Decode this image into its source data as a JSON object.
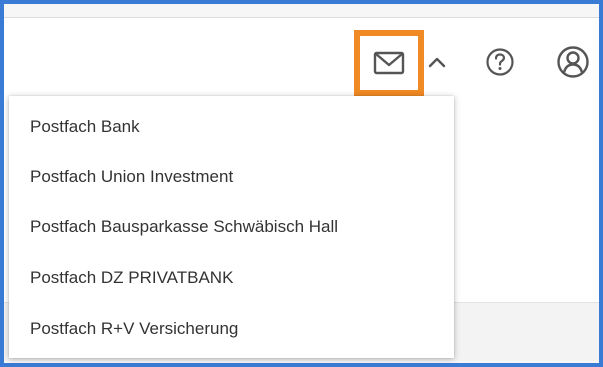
{
  "toolbar": {
    "mail_icon": "mail-envelope-icon",
    "chevron_icon": "chevron-up-icon",
    "help_icon": "help-question-icon",
    "user_icon": "user-account-icon",
    "highlight_color": "#f08a24",
    "icon_color": "#555555"
  },
  "mailbox_menu": {
    "items": [
      {
        "label": "Postfach Bank"
      },
      {
        "label": "Postfach Union Investment"
      },
      {
        "label": "Postfach Bausparkasse Schwäbisch Hall"
      },
      {
        "label": "Postfach DZ PRIVATBANK"
      },
      {
        "label": "Postfach R+V Versicherung"
      }
    ]
  },
  "frame": {
    "border_color": "#3a7bd5"
  }
}
